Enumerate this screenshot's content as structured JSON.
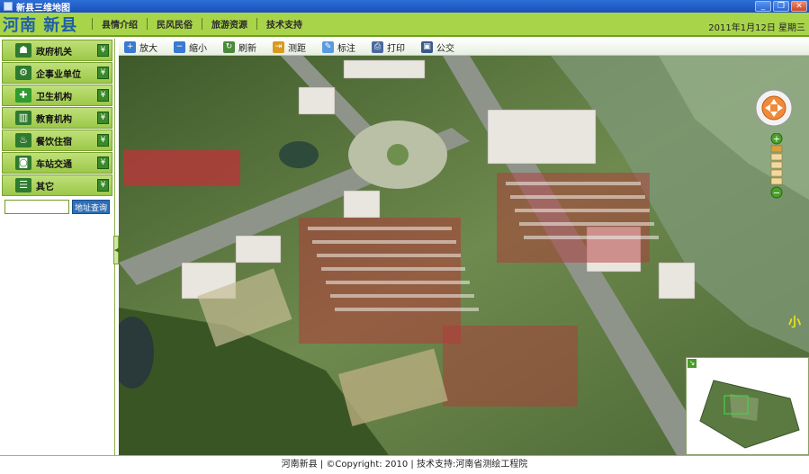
{
  "window": {
    "title": "新县三维地图",
    "minimize": "_",
    "restore": "❐",
    "close": "✕"
  },
  "header": {
    "brand": "河南 新县",
    "nav": [
      "县情介绍",
      "民风民俗",
      "旅游资源",
      "技术支持"
    ],
    "date": "2011年1月12日 星期三"
  },
  "sidebar": {
    "items": [
      {
        "label": "政府机关",
        "icon": "government-icon",
        "color": "#2f7a2f"
      },
      {
        "label": "企事业单位",
        "icon": "enterprise-icon",
        "color": "#2f7a2f"
      },
      {
        "label": "卫生机构",
        "icon": "medical-cross-icon",
        "color": "#2f9a2f"
      },
      {
        "label": "教育机构",
        "icon": "education-icon",
        "color": "#2f7a2f"
      },
      {
        "label": "餐饮住宿",
        "icon": "dining-icon",
        "color": "#2f7a2f"
      },
      {
        "label": "车站交通",
        "icon": "bus-icon",
        "color": "#2f7a2f"
      },
      {
        "label": "其它",
        "icon": "other-icon",
        "color": "#2f7a2f"
      }
    ],
    "search_value": "",
    "search_button": "地址查询"
  },
  "toolbar": {
    "tools": [
      {
        "label": "放大",
        "icon": "zoom-in-icon",
        "color": "#3a7ad0"
      },
      {
        "label": "缩小",
        "icon": "zoom-out-icon",
        "color": "#3a7ad0"
      },
      {
        "label": "刷新",
        "icon": "refresh-icon",
        "color": "#4a8a3a"
      },
      {
        "label": "测距",
        "icon": "measure-icon",
        "color": "#d89a20"
      },
      {
        "label": "标注",
        "icon": "label-icon",
        "color": "#5a9ae0"
      },
      {
        "label": "打印",
        "icon": "print-icon",
        "color": "#4a6aa0"
      },
      {
        "label": "公交",
        "icon": "bus-icon",
        "color": "#3a5a8a"
      }
    ]
  },
  "map": {
    "corner_text": "小"
  },
  "footer": {
    "text": "河南新县  |  ©Copyright: 2010  |  技术支持:河南省测绘工程院"
  }
}
